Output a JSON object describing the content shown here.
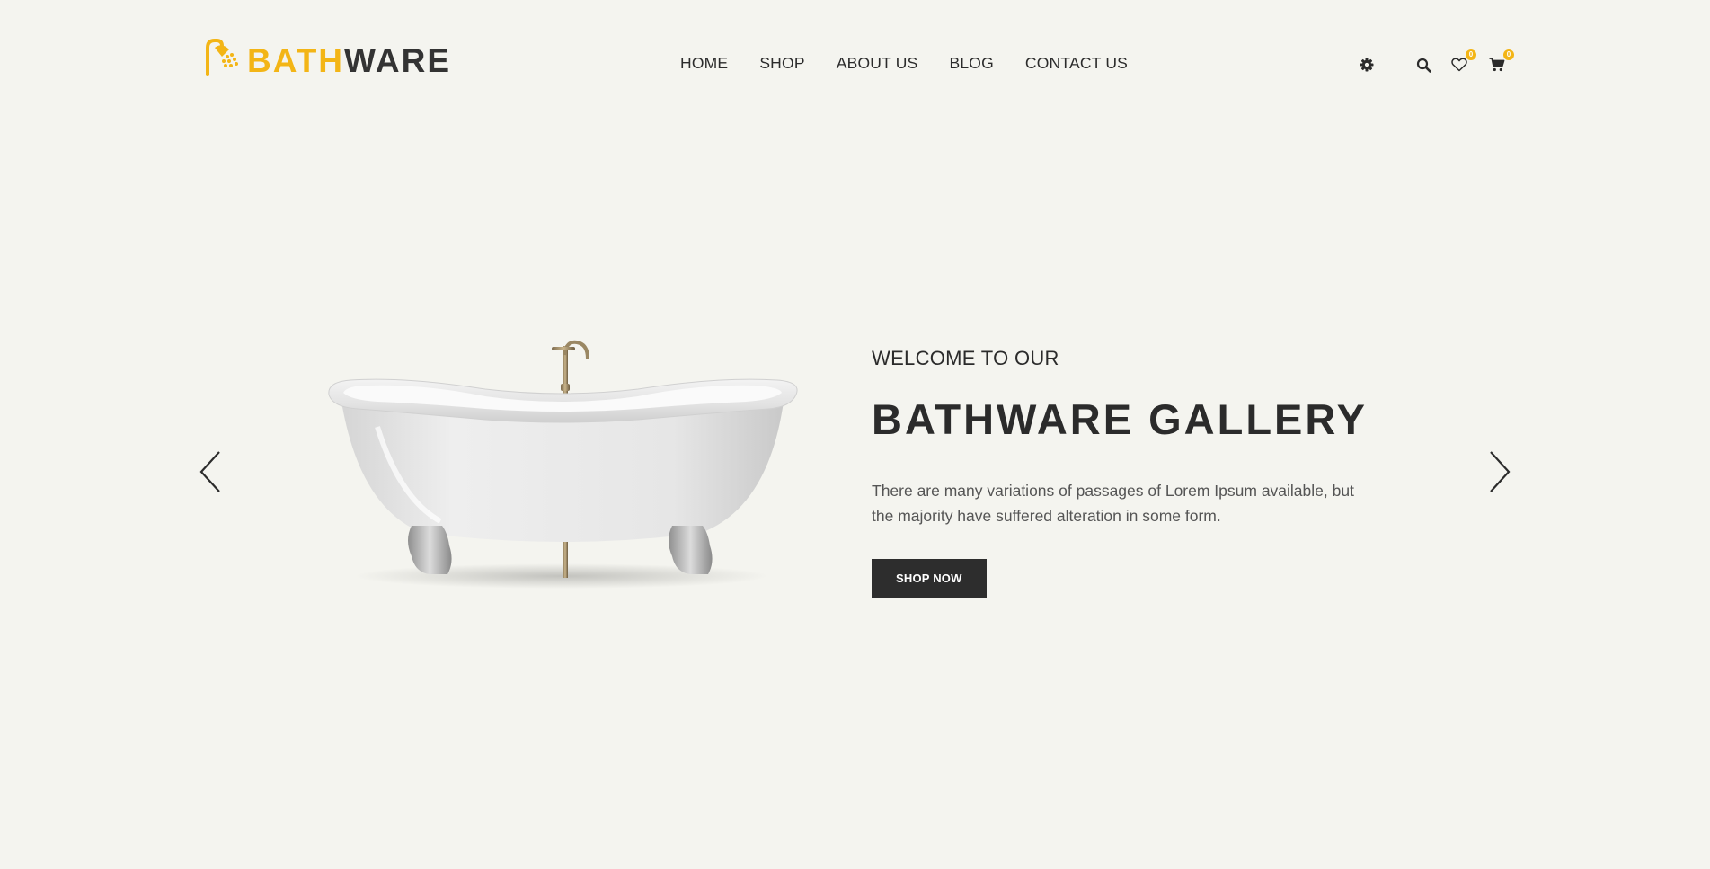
{
  "brand": {
    "name_part1": "BATH",
    "name_part2": "WARE",
    "accent_color": "#f3b516",
    "dark_color": "#333333",
    "icon": "shower-head-icon"
  },
  "nav": {
    "items": [
      {
        "label": "HOME"
      },
      {
        "label": "SHOP"
      },
      {
        "label": "ABOUT US"
      },
      {
        "label": "BLOG"
      },
      {
        "label": "CONTACT US"
      }
    ]
  },
  "header_icons": {
    "settings": "gear-icon",
    "search": "search-icon",
    "wishlist": {
      "icon": "heart-icon",
      "count": "0"
    },
    "cart": {
      "icon": "cart-icon",
      "count": "0"
    }
  },
  "hero": {
    "kicker": "WELCOME TO OUR",
    "headline": "BATHWARE GALLERY",
    "description": "There are many variations of passages of Lorem Ipsum available, but the majority have suffered alteration in some form.",
    "cta_label": "SHOP NOW",
    "image": "clawfoot-bathtub-image",
    "prev_icon": "chevron-left-icon",
    "next_icon": "chevron-right-icon"
  },
  "colors": {
    "background": "#f4f4ef",
    "button": "#2d2d2d"
  }
}
